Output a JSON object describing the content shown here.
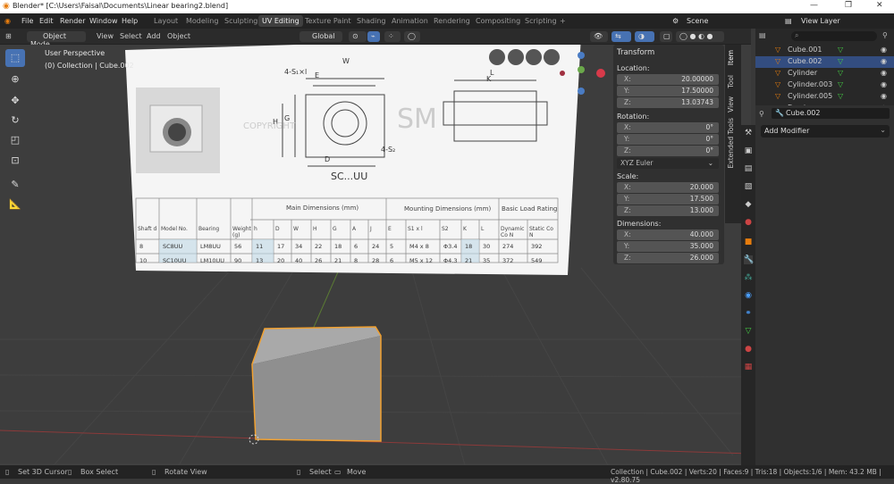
{
  "window": {
    "title": "Blender* [C:\\Users\\Faisal\\Documents\\Linear bearing2.blend]",
    "controls": [
      "—",
      "❐",
      "✕"
    ]
  },
  "menu": [
    "File",
    "Edit",
    "Render",
    "Window",
    "Help"
  ],
  "workspaces": [
    "Layout",
    "Modeling",
    "Sculpting",
    "UV Editing",
    "Texture Paint",
    "Shading",
    "Animation",
    "Rendering",
    "Compositing",
    "Scripting"
  ],
  "active_workspace": "UV Editing",
  "top_right": {
    "scene": "Scene",
    "view_layer": "View Layer"
  },
  "header": {
    "mode": "Object Mode",
    "menus": [
      "View",
      "Select",
      "Add",
      "Object"
    ],
    "orientation": "Global"
  },
  "viewport": {
    "perspective": "User Perspective",
    "collection_info": "(0) Collection | Cube.002"
  },
  "image_plane": {
    "part": "SC...UU",
    "dim_labels": {
      "w": "W",
      "l": "L",
      "h": "H",
      "g": "G",
      "d": "D",
      "s1": "4-S₁×l",
      "s2": "4-S₂",
      "k": "K",
      "e": "E"
    },
    "watermark": "SM",
    "copyright": "COPYRIGHT",
    "table": {
      "group_headers": [
        "Main Dimensions (mm)",
        "Mounting Dimensions (mm)",
        "Basic Load Rating"
      ],
      "col_headers": [
        "Shaft d",
        "Model No.",
        "Bearing",
        "Weight (g)",
        "h",
        "D",
        "W",
        "H",
        "G",
        "A",
        "J",
        "E",
        "S1 x l",
        "S2",
        "K",
        "L",
        "Dynamic Co N",
        "Static Co N"
      ],
      "rows": [
        [
          "8",
          "SC8UU",
          "LM8UU",
          "56",
          "11",
          "17",
          "34",
          "22",
          "18",
          "6",
          "24",
          "5",
          "M4 x 8",
          "Φ3.4",
          "18",
          "30",
          "274",
          "392"
        ],
        [
          "10",
          "SC10UU",
          "LM10UU",
          "90",
          "13",
          "20",
          "40",
          "26",
          "21",
          "8",
          "28",
          "6",
          "M5 x 12",
          "Φ4.3",
          "21",
          "35",
          "372",
          "549"
        ]
      ]
    }
  },
  "npanel": {
    "tabs": [
      "Item",
      "Tool",
      "View",
      "Extended Tools"
    ],
    "section": "Transform",
    "location_label": "Location:",
    "location": [
      {
        "axis": "X:",
        "value": "20.00000"
      },
      {
        "axis": "Y:",
        "value": "17.50000"
      },
      {
        "axis": "Z:",
        "value": "13.03743"
      }
    ],
    "rotation_label": "Rotation:",
    "rotation": [
      {
        "axis": "X:",
        "value": "0°"
      },
      {
        "axis": "Y:",
        "value": "0°"
      },
      {
        "axis": "Z:",
        "value": "0°"
      }
    ],
    "rotation_mode": "XYZ Euler",
    "scale_label": "Scale:",
    "scale": [
      {
        "axis": "X:",
        "value": "20.000"
      },
      {
        "axis": "Y:",
        "value": "17.500"
      },
      {
        "axis": "Z:",
        "value": "13.000"
      }
    ],
    "dimensions_label": "Dimensions:",
    "dimensions": [
      {
        "axis": "X:",
        "value": "40.000"
      },
      {
        "axis": "Y:",
        "value": "35.000"
      },
      {
        "axis": "Z:",
        "value": "26.000"
      }
    ]
  },
  "outliner": {
    "items": [
      "Cube.001",
      "Cube.002",
      "Cylinder",
      "Cylinder.003",
      "Cylinder.005",
      "Empty"
    ],
    "selected": "Cube.002"
  },
  "properties": {
    "object_name": "Cube.002",
    "add_modifier": "Add Modifier"
  },
  "status": {
    "left": [
      {
        "label": "Set 3D Cursor"
      },
      {
        "label": "Box Select"
      },
      {
        "label": "Rotate View"
      },
      {
        "label": "Select"
      },
      {
        "label": "Move"
      }
    ],
    "right": "Collection | Cube.002 | Verts:20 | Faces:9 | Tris:18 | Objects:1/6 | Mem: 43.2 MB | v2.80.75"
  },
  "colors": {
    "accent": "#4772b3",
    "selection_orange": "#f0a030",
    "x_axis": "#b34a4a",
    "y_axis": "#6a9a3a"
  }
}
